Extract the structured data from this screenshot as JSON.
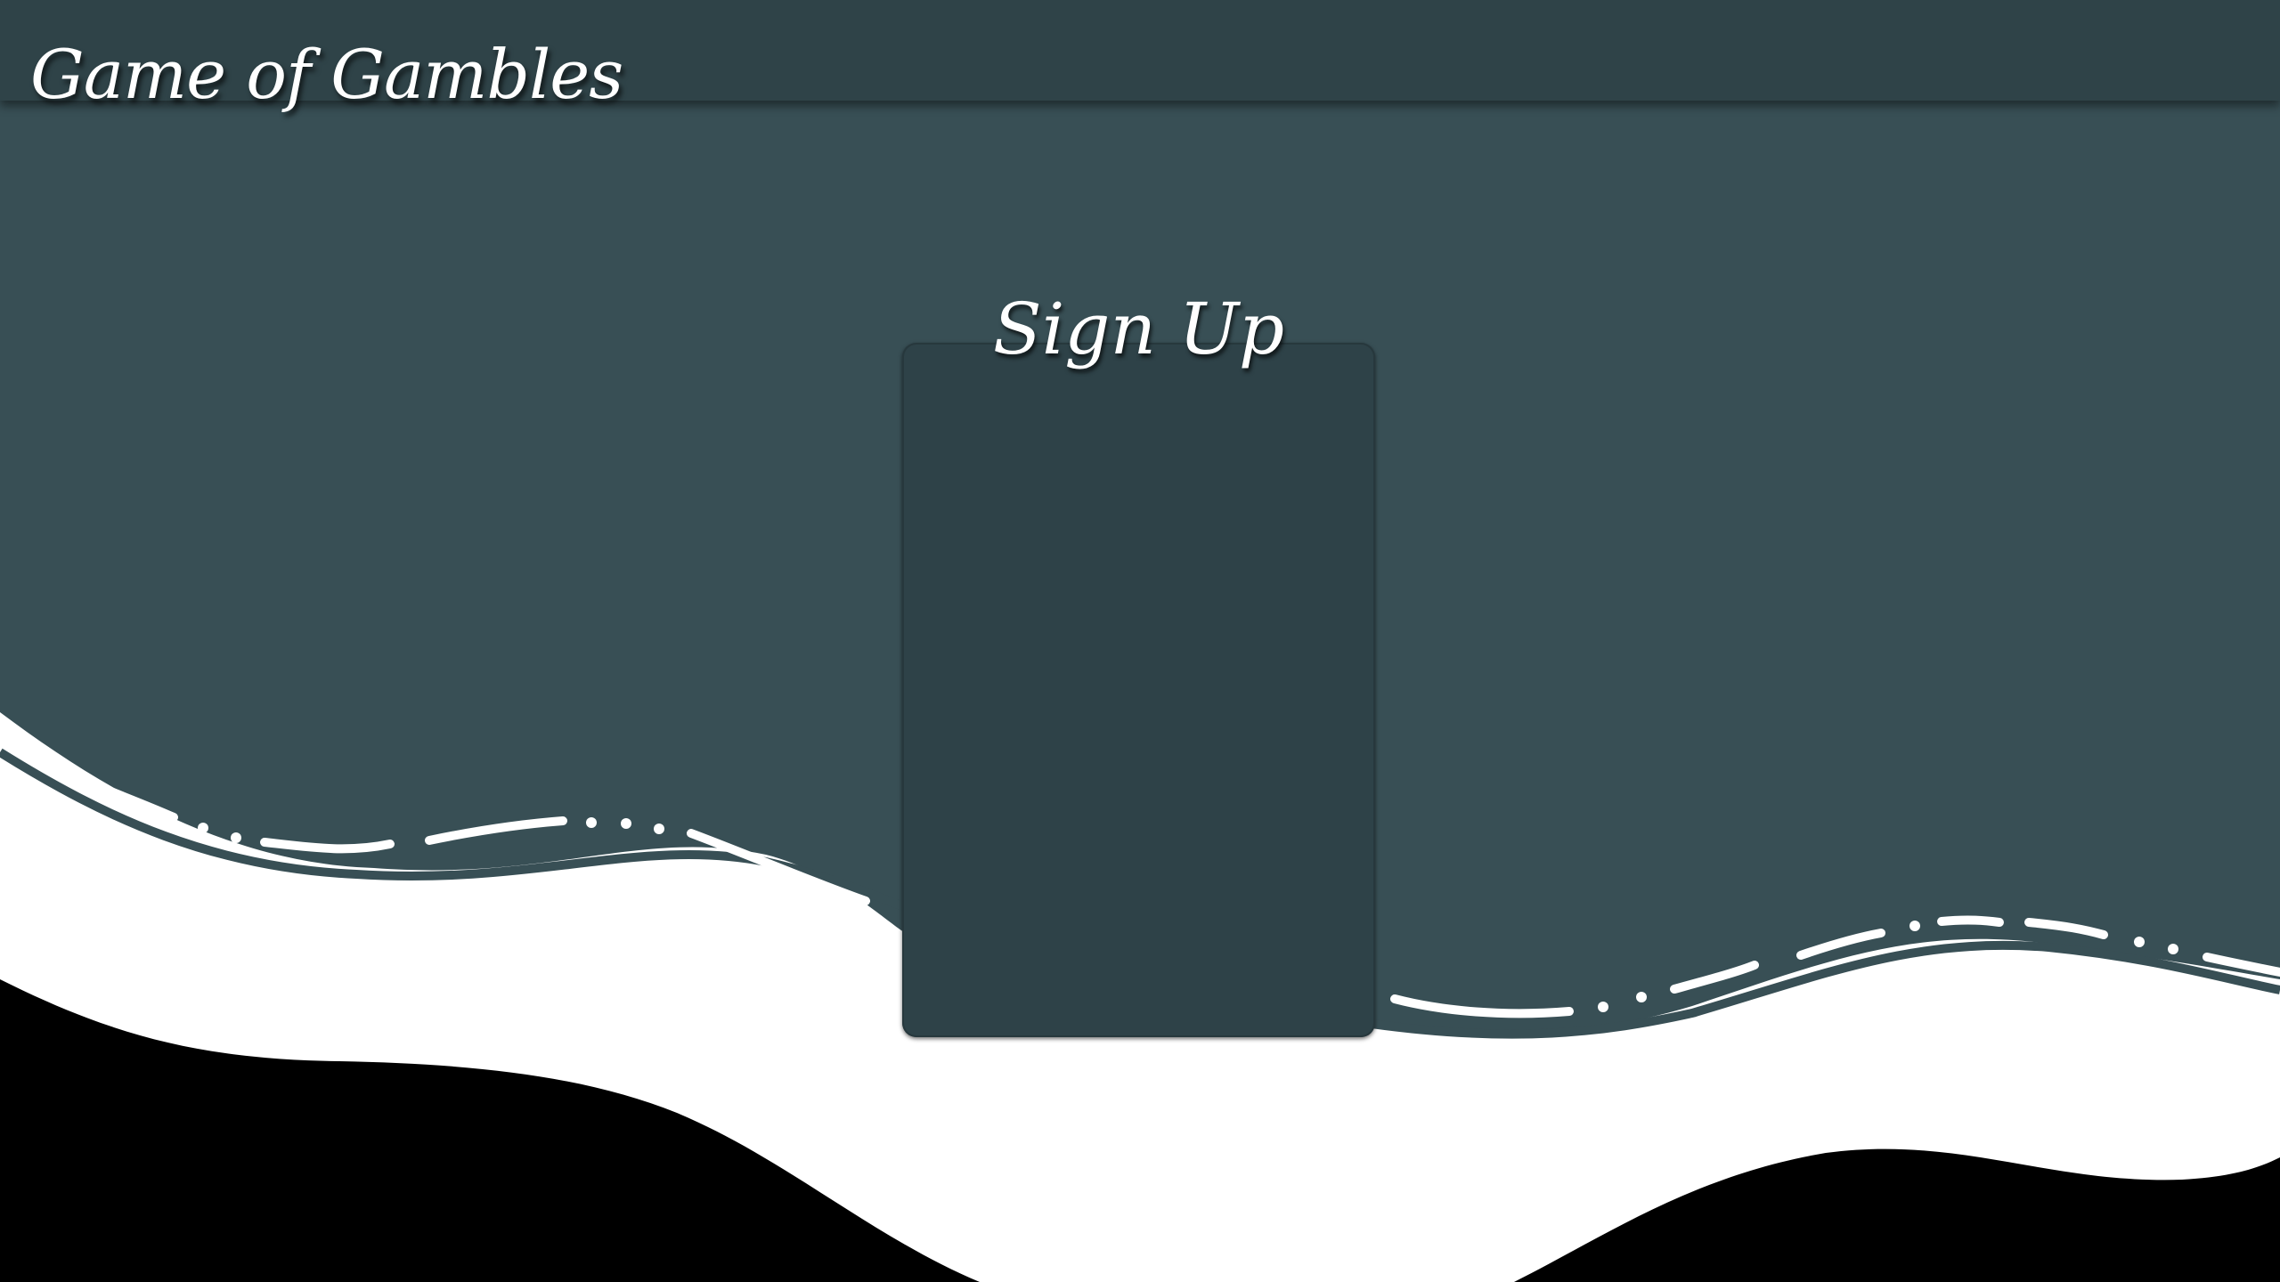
{
  "header": {
    "app_title": "Game of Gambles"
  },
  "signup_card": {
    "title": "Sign Up"
  },
  "colors": {
    "background": "#384f55",
    "header_bar": "#2f4348",
    "card": "#2e4248",
    "wave_white": "#ffffff",
    "wave_black": "#000000"
  }
}
